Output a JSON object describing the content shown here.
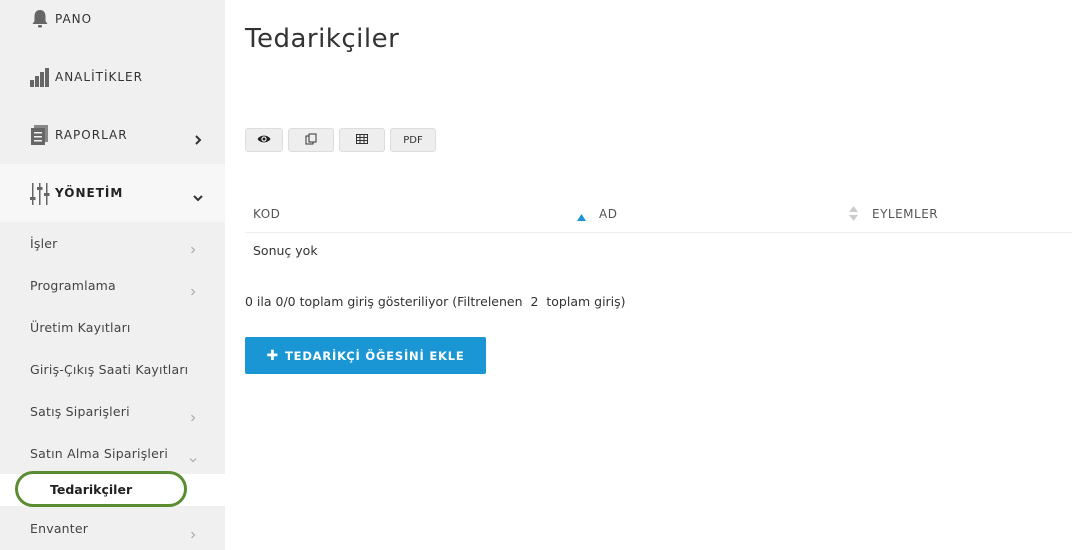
{
  "sidebar": {
    "top_items": [
      {
        "label": "PANO",
        "icon": "bell-icon"
      },
      {
        "label": "ANALİTİKLER",
        "icon": "bar-chart-icon"
      },
      {
        "label": "RAPORLAR",
        "icon": "reports-icon"
      },
      {
        "label": "YÖNETİM",
        "icon": "sliders-icon"
      }
    ],
    "sub_items": [
      {
        "label": "İşler"
      },
      {
        "label": "Programlama"
      },
      {
        "label": "Üretim Kayıtları"
      },
      {
        "label": "Giriş-Çıkış Saati Kayıtları"
      },
      {
        "label": "Satış Siparişleri"
      },
      {
        "label": "Satın Alma Siparişleri"
      },
      {
        "label": "Envanter"
      }
    ],
    "active_child": "Tedarikçiler"
  },
  "main": {
    "title": "Tedarikçiler",
    "toolbar": {
      "pdf_label": "PDF"
    },
    "table": {
      "columns": [
        "KOD",
        "AD",
        "EYLEMLER"
      ],
      "empty_text": "Sonuç yok"
    },
    "info_text": "0 ila 0/0 toplam giriş gösteriliyor (Filtrelenen  2  toplam giriş)",
    "add_button_label": "TEDARİKÇİ ÖĞESİNİ EKLE"
  },
  "colors": {
    "accent": "#1a96d4",
    "highlight": "#5a8c32",
    "sidebar_bg": "#f0f0f0"
  }
}
